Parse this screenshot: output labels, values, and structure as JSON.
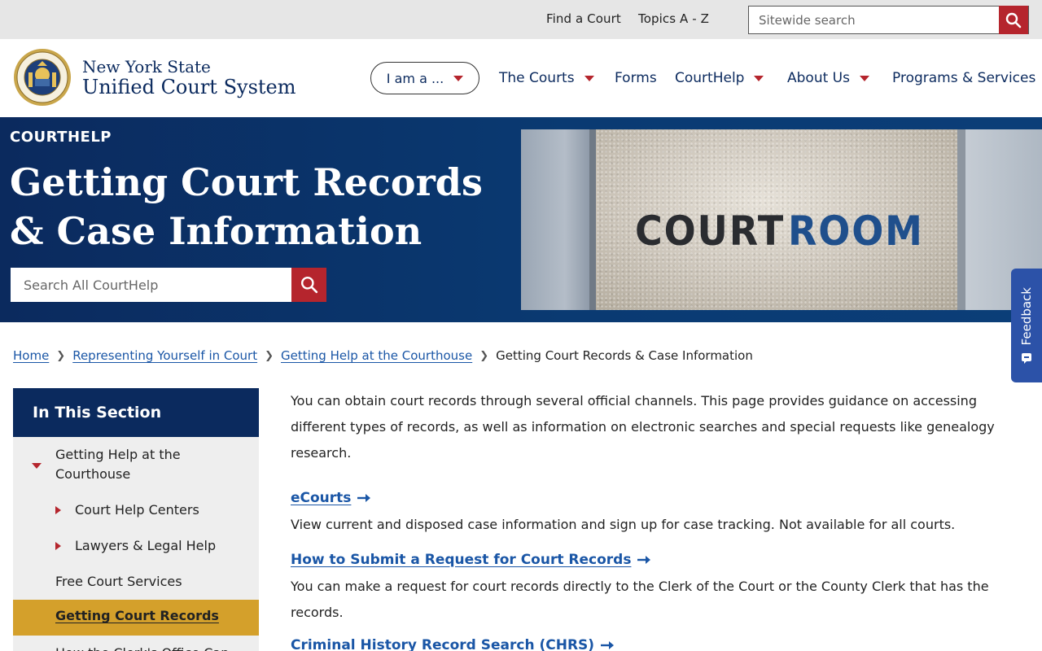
{
  "utility": {
    "find_court": "Find a Court",
    "topics": "Topics A - Z",
    "search_placeholder": "Sitewide search"
  },
  "brand": {
    "line1": "New York State",
    "line2": "Unified Court System",
    "seal_icon": "nys-seal-icon"
  },
  "nav": {
    "iam": "I am a ...",
    "courts": "The Courts",
    "forms": "Forms",
    "courthelp": "CourtHelp",
    "about": "About Us",
    "programs": "Programs & Services"
  },
  "hero": {
    "eyebrow": "COURTHELP",
    "title": "Getting Court Records & Case Information",
    "search_placeholder": "Search All CourtHelp",
    "photo_word1": "COURT",
    "photo_word2": "ROOM"
  },
  "feedback": {
    "label": "Feedback"
  },
  "breadcrumb": {
    "home": "Home",
    "level1": "Representing Yourself in Court",
    "level2": "Getting Help at the Courthouse",
    "current": "Getting Court Records & Case Information"
  },
  "sidebar": {
    "heading": "In This Section",
    "items": [
      {
        "label": "Getting Help at the Courthouse"
      },
      {
        "label": "Court Help Centers"
      },
      {
        "label": "Lawyers & Legal Help"
      },
      {
        "label": "Free Court Services"
      },
      {
        "label": "Getting Court Records"
      },
      {
        "label": "How the Clerk's Office Can Help"
      }
    ]
  },
  "content": {
    "intro": "You can obtain court records through several official channels. This page provides guidance on accessing different types of records, as well as information on electronic searches and special requests like genealogy research.",
    "resources": [
      {
        "title": "eCourts",
        "desc": "View current and disposed case information and sign up for case tracking. Not available for all courts."
      },
      {
        "title": "How to Submit a Request for Court Records",
        "desc": "You can make a request for court records directly to the Clerk of the Court or the County Clerk that has the records."
      },
      {
        "title": "Criminal History Record Search (CHRS)",
        "desc": ""
      }
    ]
  },
  "colors": {
    "navy": "#0b2a5e",
    "accent_red": "#b5252d",
    "link_blue": "#1a56a6",
    "active_gold": "#d4a02b",
    "feedback_blue": "#2c52a8"
  }
}
